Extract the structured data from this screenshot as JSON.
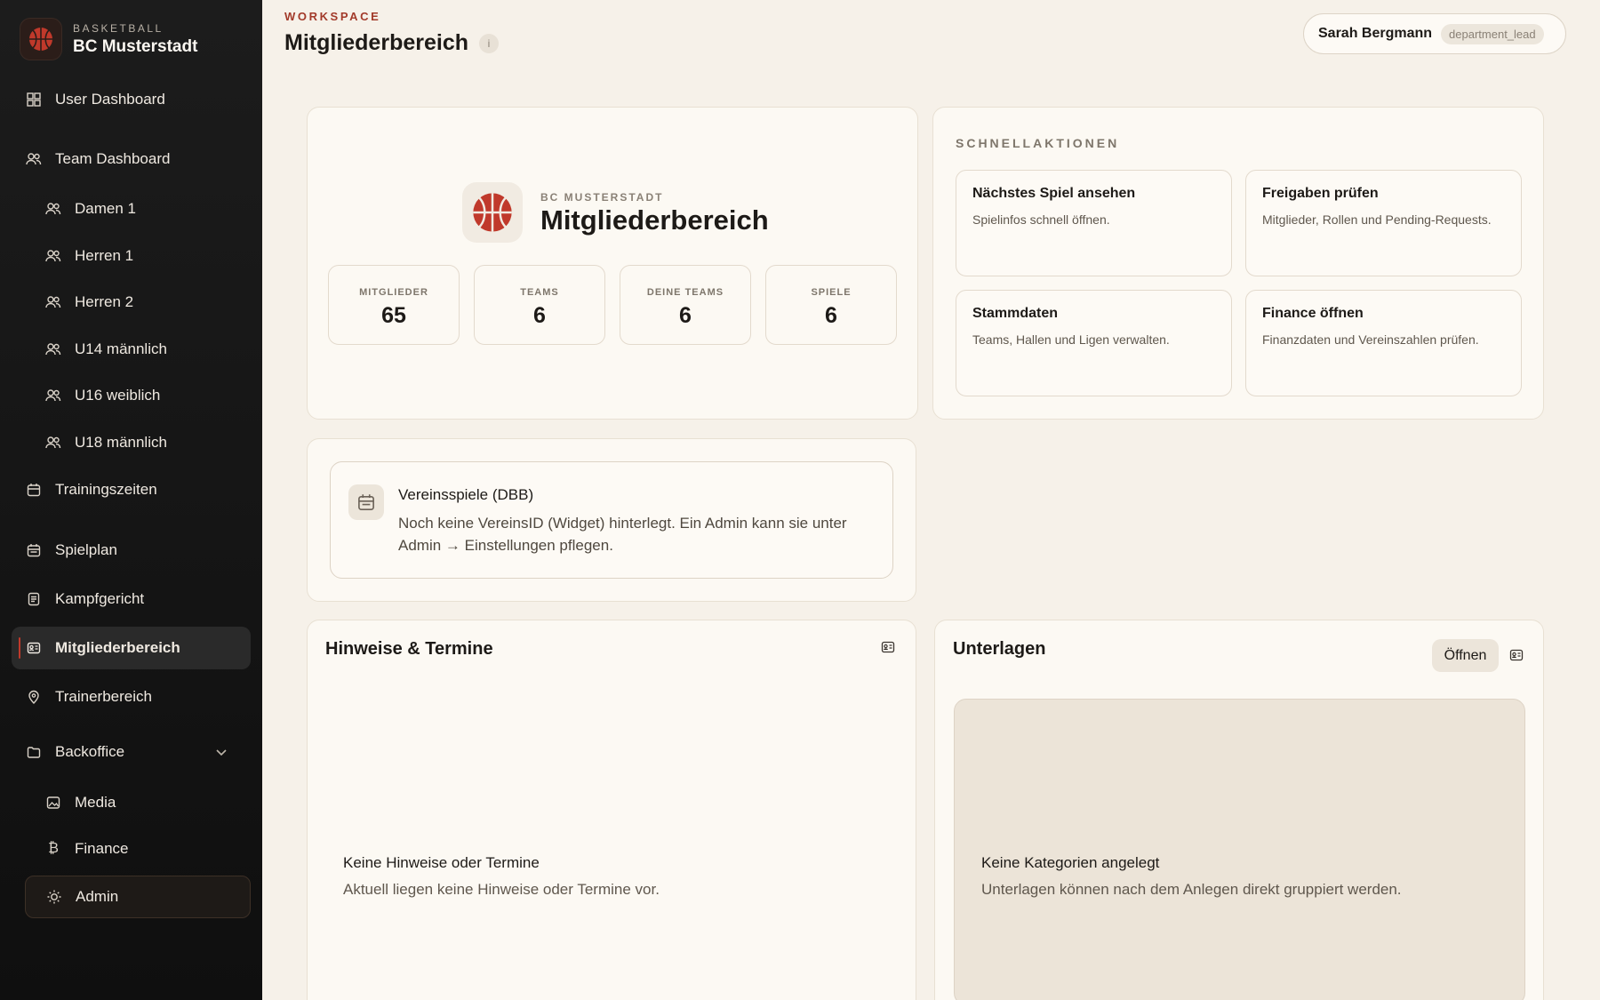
{
  "brand": {
    "kicker": "BASKETBALL",
    "name": "BC Musterstadt",
    "logo_icon": "basketball-icon",
    "accent": "#c0392b"
  },
  "sidebar": {
    "items": [
      {
        "label": "User Dashboard",
        "icon": "grid-icon"
      },
      {
        "label": "Team Dashboard",
        "icon": "users-icon"
      },
      {
        "label": "Damen 1",
        "icon": "users-icon"
      },
      {
        "label": "Herren 1",
        "icon": "users-icon"
      },
      {
        "label": "Herren 2",
        "icon": "users-icon"
      },
      {
        "label": "U14 männlich",
        "icon": "users-icon"
      },
      {
        "label": "U16 weiblich",
        "icon": "users-icon"
      },
      {
        "label": "U18 männlich",
        "icon": "users-icon"
      },
      {
        "label": "Trainingszeiten",
        "icon": "calendar-icon"
      },
      {
        "label": "Spielplan",
        "icon": "calendar-icon"
      },
      {
        "label": "Kampfgericht",
        "icon": "clipboard-icon"
      },
      {
        "label": "Mitgliederbereich",
        "icon": "id-card-icon",
        "active": true
      },
      {
        "label": "Trainerbereich",
        "icon": "map-pin-icon"
      },
      {
        "label": "Backoffice",
        "icon": "folder-icon",
        "expanded": true
      },
      {
        "label": "Media",
        "icon": "image-icon"
      },
      {
        "label": "Finance",
        "icon": "bitcoin-icon"
      },
      {
        "label": "Admin",
        "icon": "sun-icon"
      }
    ]
  },
  "header": {
    "kicker": "WORKSPACE",
    "title": "Mitgliederbereich",
    "info": "i"
  },
  "user": {
    "name": "Sarah Bergmann",
    "role": "department_lead"
  },
  "hero": {
    "kicker": "BC MUSTERSTADT",
    "title": "Mitgliederbereich",
    "stats": [
      {
        "label": "MITGLIEDER",
        "value": "65"
      },
      {
        "label": "TEAMS",
        "value": "6"
      },
      {
        "label": "DEINE TEAMS",
        "value": "6"
      },
      {
        "label": "SPIELE",
        "value": "6"
      }
    ]
  },
  "quick_actions": {
    "kicker": "SCHNELLAKTIONEN",
    "items": [
      {
        "title": "Nächstes Spiel ansehen",
        "desc": "Spielinfos schnell öffnen."
      },
      {
        "title": "Freigaben prüfen",
        "desc": "Mitglieder, Rollen und Pending-Requests."
      },
      {
        "title": "Stammdaten",
        "desc": "Teams, Hallen und Ligen verwalten."
      },
      {
        "title": "Finance öffnen",
        "desc": "Finanzdaten und Vereinszahlen prüfen."
      }
    ]
  },
  "dbb": {
    "title": "Vereinsspiele (DBB)",
    "desc": "Noch keine VereinsID (Widget) hinterlegt. Ein Admin kann sie unter Admin → Einstellungen pflegen."
  },
  "notices": {
    "title": "Hinweise & Termine",
    "empty_title": "Keine Hinweise oder Termine",
    "empty_desc": "Aktuell liegen keine Hinweise oder Termine vor."
  },
  "docs": {
    "title": "Unterlagen",
    "open_label": "Öffnen",
    "empty_title": "Keine Kategorien angelegt",
    "empty_desc": "Unterlagen können nach dem Anlegen direkt gruppiert werden."
  }
}
